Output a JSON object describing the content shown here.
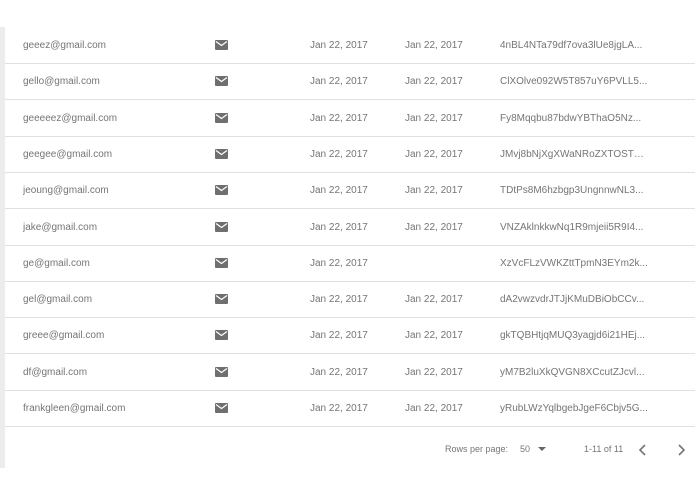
{
  "rows": [
    {
      "email": "geeez@gmail.com",
      "icon": "mail-icon",
      "date1": "Jan 22, 2017",
      "date2": "Jan 22, 2017",
      "token": "4nBL4NTa79df7ova3lUe8jgLA..."
    },
    {
      "email": "gello@gmail.com",
      "icon": "mail-icon",
      "date1": "Jan 22, 2017",
      "date2": "Jan 22, 2017",
      "token": "ClXOlve092W5T857uY6PVLL5..."
    },
    {
      "email": "geeeeez@gmail.com",
      "icon": "mail-icon",
      "date1": "Jan 22, 2017",
      "date2": "Jan 22, 2017",
      "token": "Fy8Mqqbu87bdwYBThaO5Nz..."
    },
    {
      "email": "geegee@gmail.com",
      "icon": "mail-icon",
      "date1": "Jan 22, 2017",
      "date2": "Jan 22, 2017",
      "token": "JMvj8bNjXgXWaNRoZXTOSTG..."
    },
    {
      "email": "jeoung@gmail.com",
      "icon": "mail-icon",
      "date1": "Jan 22, 2017",
      "date2": "Jan 22, 2017",
      "token": "TDtPs8M6hzbgp3UngnnwNL3..."
    },
    {
      "email": "jake@gmail.com",
      "icon": "mail-icon",
      "date1": "Jan 22, 2017",
      "date2": "Jan 22, 2017",
      "token": "VNZAklnkkwNq1R9mjeii5R9I4..."
    },
    {
      "email": "ge@gmail.com",
      "icon": "mail-icon",
      "date1": "Jan 22, 2017",
      "date2": "",
      "token": "XzVcFLzVWKZttTpmN3EYm2k..."
    },
    {
      "email": "gel@gmail.com",
      "icon": "mail-icon",
      "date1": "Jan 22, 2017",
      "date2": "Jan 22, 2017",
      "token": "dA2vwzvdrJTJjKMuDBiObCCv..."
    },
    {
      "email": "greee@gmail.com",
      "icon": "mail-icon",
      "date1": "Jan 22, 2017",
      "date2": "Jan 22, 2017",
      "token": "gkTQBHtjqMUQ3yagjd6i21HEj..."
    },
    {
      "email": "df@gmail.com",
      "icon": "mail-icon",
      "date1": "Jan 22, 2017",
      "date2": "Jan 22, 2017",
      "token": "yM7B2luXkQVGN8XCcutZJcvl..."
    },
    {
      "email": "frankgleen@gmail.com",
      "icon": "mail-icon",
      "date1": "Jan 22, 2017",
      "date2": "Jan 22, 2017",
      "token": "yRubLWzYqlbgebJgeF6Cbjv5G..."
    }
  ],
  "footer": {
    "rows_per_page_label": "Rows per page:",
    "rows_per_page_value": "50",
    "range_text": "1-11 of 11",
    "prev_icon": "chevron-left-icon",
    "next_icon": "chevron-right-icon"
  },
  "colors": {
    "text": "#757575",
    "divider": "#e0e0e0",
    "icon": "#6f6f6f"
  }
}
